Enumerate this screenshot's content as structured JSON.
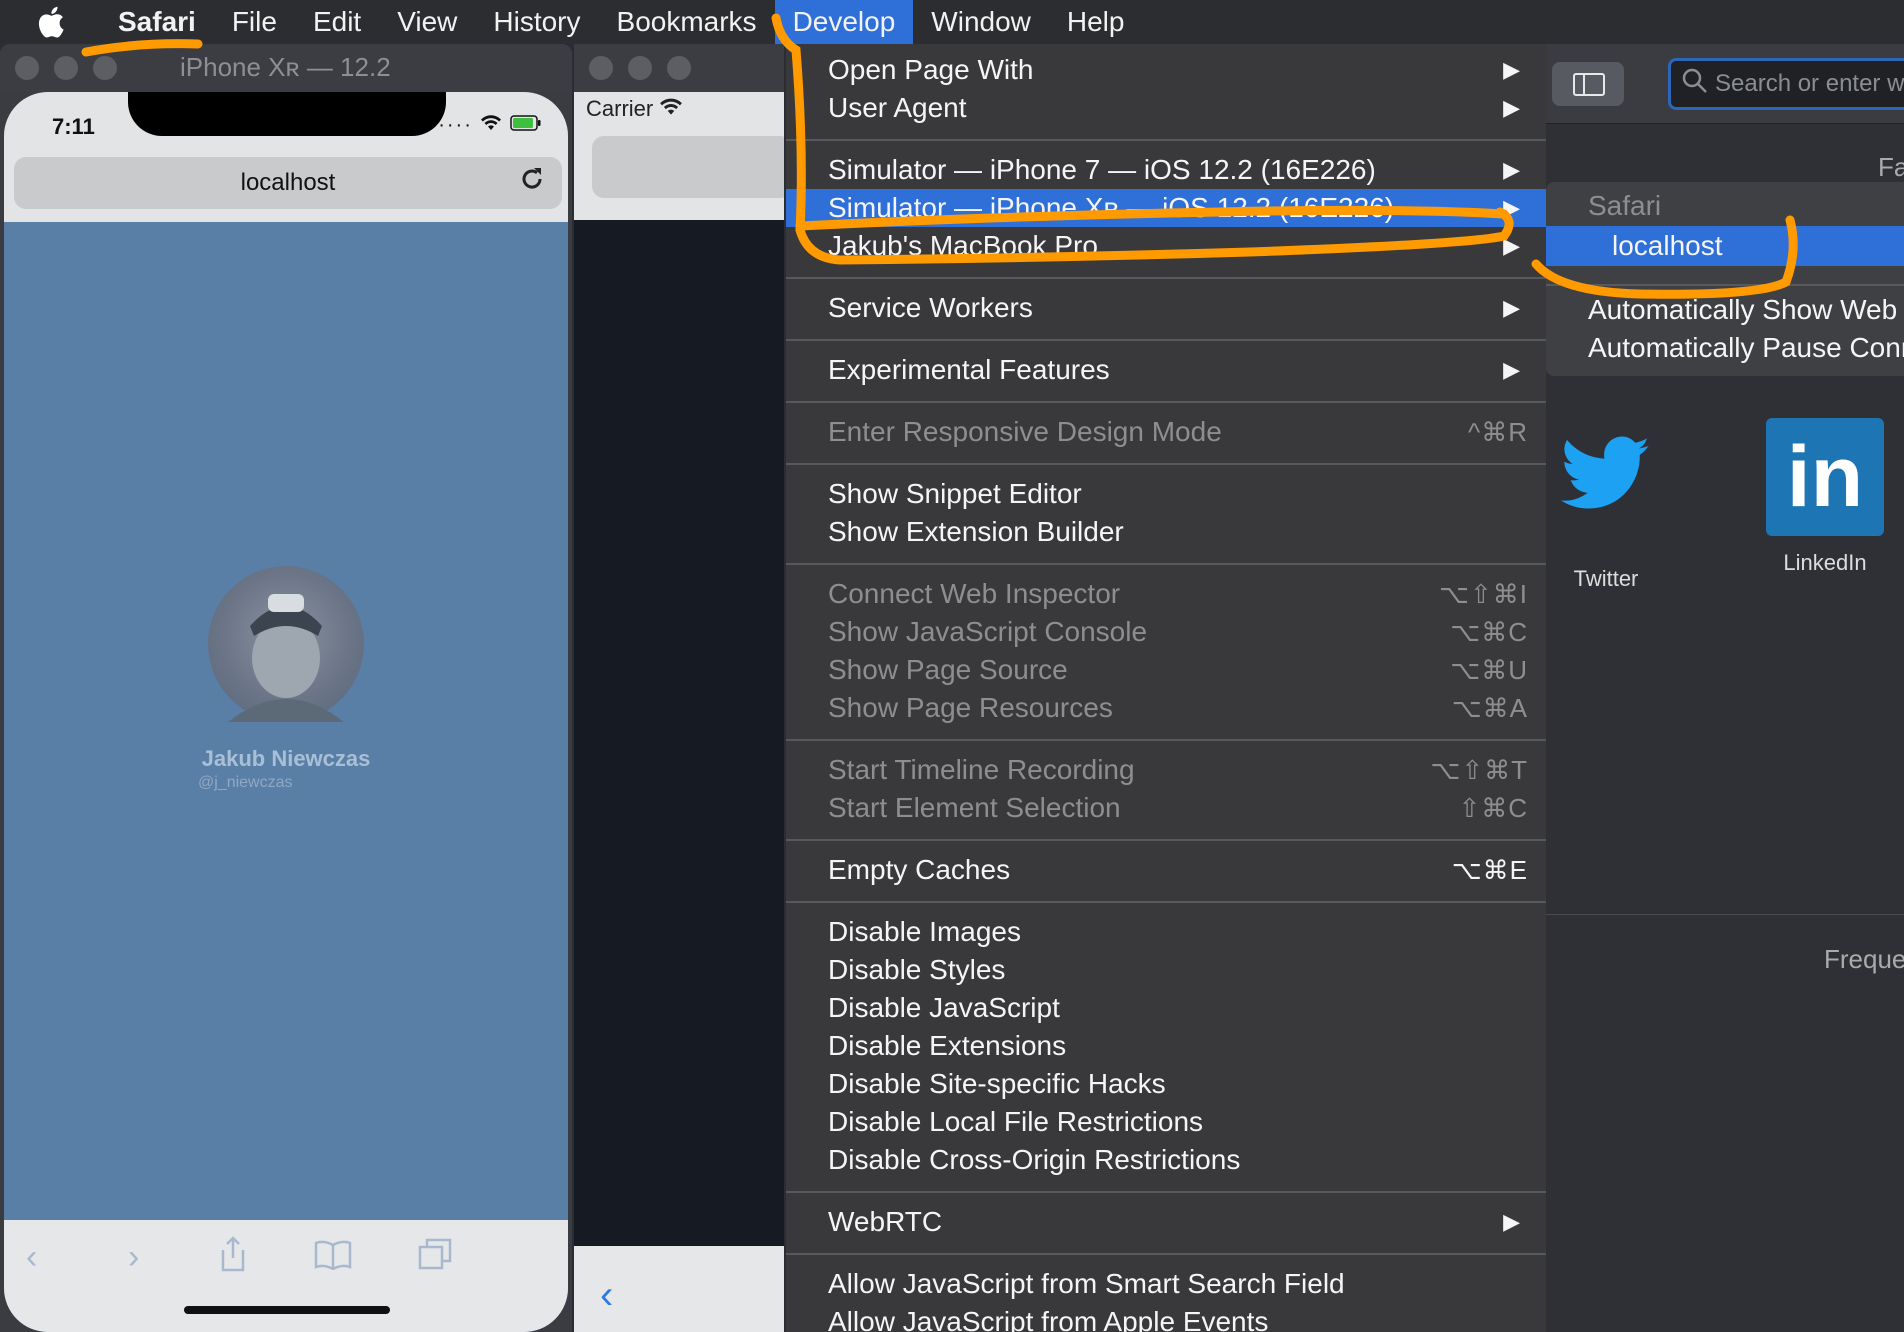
{
  "menubar": {
    "apple_icon": "apple-logo-icon",
    "items": [
      {
        "label": "Safari"
      },
      {
        "label": "File"
      },
      {
        "label": "Edit"
      },
      {
        "label": "View"
      },
      {
        "label": "History"
      },
      {
        "label": "Bookmarks"
      },
      {
        "label": "Develop"
      },
      {
        "label": "Window"
      },
      {
        "label": "Help"
      }
    ]
  },
  "simulator": {
    "window_title": "iPhone Xʀ — 12.2",
    "time": "7:11",
    "url": "localhost",
    "profile_name": "Jakub Niewczas",
    "profile_handle": "@j_niewczas"
  },
  "simulator2": {
    "carrier": "Carrier"
  },
  "develop_menu": {
    "items": [
      {
        "label": "Open Page With",
        "submenu": true
      },
      {
        "label": "User Agent",
        "submenu": true
      },
      {
        "label": "Simulator — iPhone 7 — iOS 12.2 (16E226)",
        "submenu": true
      },
      {
        "label": "Simulator — iPhone Xʀ — iOS 12.2 (16E226)",
        "submenu": true
      },
      {
        "label": "Jakub's MacBook Pro",
        "submenu": true
      },
      {
        "label": "Service Workers",
        "submenu": true
      },
      {
        "label": "Experimental Features",
        "submenu": true
      },
      {
        "label": "Enter Responsive Design Mode",
        "shortcut": "^⌘R"
      },
      {
        "label": "Show Snippet Editor"
      },
      {
        "label": "Show Extension Builder"
      },
      {
        "label": "Connect Web Inspector",
        "shortcut": "⌥⇧⌘I"
      },
      {
        "label": "Show JavaScript Console",
        "shortcut": "⌥⌘C"
      },
      {
        "label": "Show Page Source",
        "shortcut": "⌥⌘U"
      },
      {
        "label": "Show Page Resources",
        "shortcut": "⌥⌘A"
      },
      {
        "label": "Start Timeline Recording",
        "shortcut": "⌥⇧⌘T"
      },
      {
        "label": "Start Element Selection",
        "shortcut": "⇧⌘C"
      },
      {
        "label": "Empty Caches",
        "shortcut": "⌥⌘E"
      },
      {
        "label": "Disable Images"
      },
      {
        "label": "Disable Styles"
      },
      {
        "label": "Disable JavaScript"
      },
      {
        "label": "Disable Extensions"
      },
      {
        "label": "Disable Site-specific Hacks"
      },
      {
        "label": "Disable Local File Restrictions"
      },
      {
        "label": "Disable Cross-Origin Restrictions"
      },
      {
        "label": "WebRTC",
        "submenu": true
      },
      {
        "label": "Allow JavaScript from Smart Search Field"
      },
      {
        "label": "Allow JavaScript from Apple Events"
      }
    ]
  },
  "submenu": {
    "header": "Safari",
    "highlighted": "localhost",
    "items": [
      {
        "label": "Automatically Show Web Inspector"
      },
      {
        "label": "Automatically Pause Connecting"
      }
    ]
  },
  "safari_window": {
    "search_placeholder": "Search or enter website name",
    "favorites_label": "Fa",
    "frequent_label": "Freque",
    "tiles": [
      {
        "label": "Twitter",
        "icon": "twitter-bird-icon"
      },
      {
        "label": "LinkedIn",
        "icon": "linkedin-logo-icon",
        "logo_text": "in"
      }
    ]
  },
  "colors": {
    "menu_highlight": "#2f6fd8",
    "annotation": "#ff9a00",
    "page_background": "#5a7fa6"
  }
}
